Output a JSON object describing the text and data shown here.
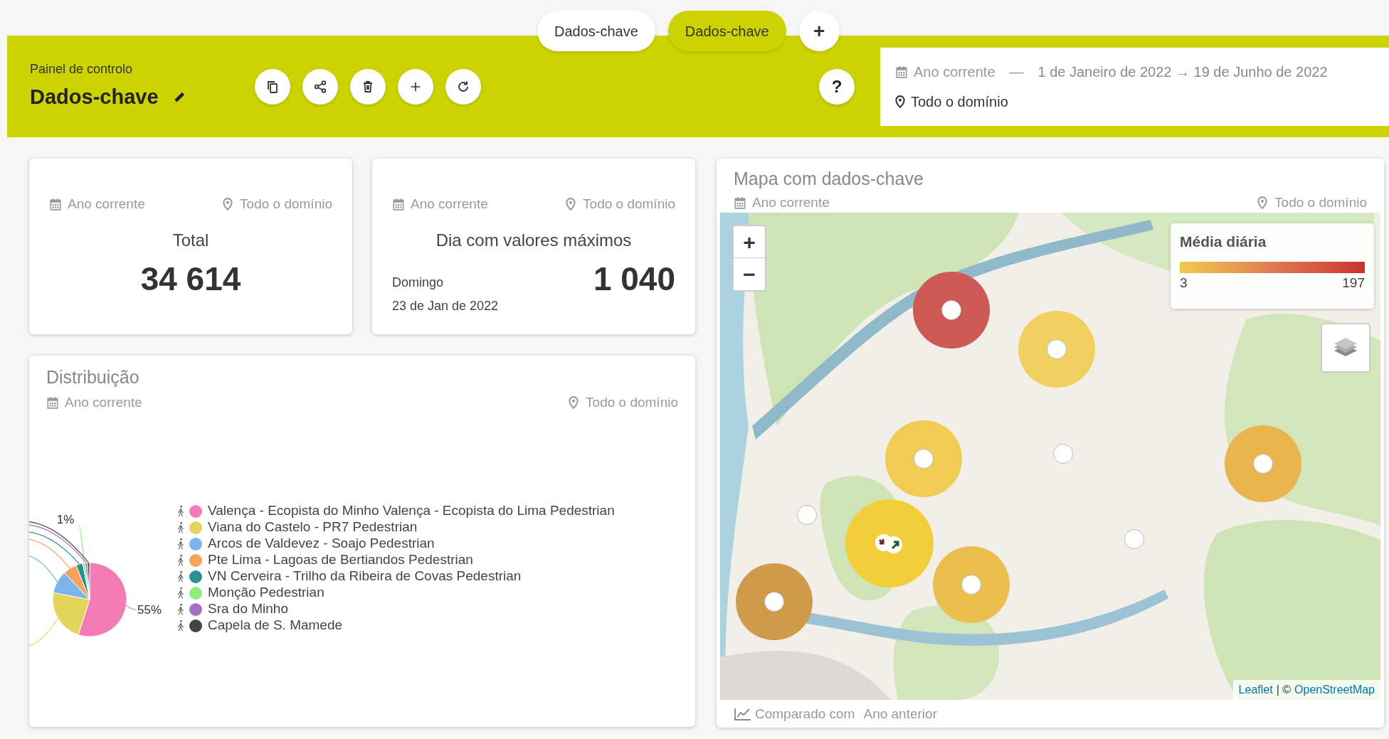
{
  "tabs": [
    {
      "label": "Dados-chave",
      "selected": false
    },
    {
      "label": "Dados-chave",
      "selected": true
    }
  ],
  "add_tab": "+",
  "header": {
    "subtitle": "Painel de controlo",
    "title": "Dados-chave",
    "help": "?",
    "period": "Ano corrente",
    "separator": "—",
    "date_range": "1 de Janeiro de 2022 → 19 de Junho de 2022",
    "scope": "Todo o domínio"
  },
  "cards": [
    {
      "kind": "total",
      "period": "Ano corrente",
      "scope": "Todo o domínio",
      "label": "Total",
      "value": "34 614"
    },
    {
      "kind": "max_day",
      "period": "Ano corrente",
      "scope": "Todo o domínio",
      "label": "Dia com valores máximos",
      "value": "1 040",
      "weekday": "Domingo",
      "date": "23 de Jan de 2022"
    }
  ],
  "distribution": {
    "title": "Distribuição",
    "period": "Ano corrente",
    "scope": "Todo o domínio",
    "chart_data": {
      "type": "pie",
      "categories": [
        "Valença - Ecopista do Minho Valença - Ecopista do Lima Pedestrian",
        "Viana do Castelo - PR7 Pedestrian",
        "Arcos de Valdevez - Soajo Pedestrian",
        "Pte Lima - Lagoas de Bertiandos Pedestrian",
        "VN Cerveira - Trilho da Ribeira de Covas Pedestrian",
        "Monção Pedestrian",
        "Sra do Minho",
        "Capela de S. Mamede"
      ],
      "colors": [
        "#f27bb5",
        "#e3d45a",
        "#7cb5ec",
        "#f7a35c",
        "#2b908f",
        "#90ed7d",
        "#a66fc4",
        "#434348"
      ],
      "values": [
        55,
        23,
        10,
        6,
        3,
        1,
        1,
        1
      ],
      "value_labels": [
        "55%",
        null,
        null,
        null,
        null,
        "1%",
        null,
        null
      ],
      "legend": "right"
    }
  },
  "map": {
    "title": "Mapa com dados-chave",
    "period": "Ano corrente",
    "scope": "Todo o domínio",
    "zoom_in": "+",
    "zoom_out": "−",
    "legend": {
      "title": "Média diária",
      "min": "3",
      "max": "197"
    },
    "markers": [
      {
        "kind": "circle",
        "color": "#cc5a52"
      },
      {
        "kind": "circle",
        "color": "#f1d060"
      },
      {
        "kind": "circle",
        "color": "#f0cc55"
      },
      {
        "kind": "point"
      },
      {
        "kind": "circle",
        "color": "#e9b54c"
      },
      {
        "kind": "point"
      },
      {
        "kind": "cluster",
        "color": "#f2cf3a"
      },
      {
        "kind": "circle",
        "color": "#ebbf4e"
      },
      {
        "kind": "circle",
        "color": "#cf9a4a"
      },
      {
        "kind": "point"
      }
    ],
    "attribution": {
      "leaflet": "Leaflet",
      "middle": "| ©",
      "osm": "OpenStreetMap"
    },
    "footer": {
      "label": "Comparado com",
      "comparison": "Ano anterior"
    }
  }
}
